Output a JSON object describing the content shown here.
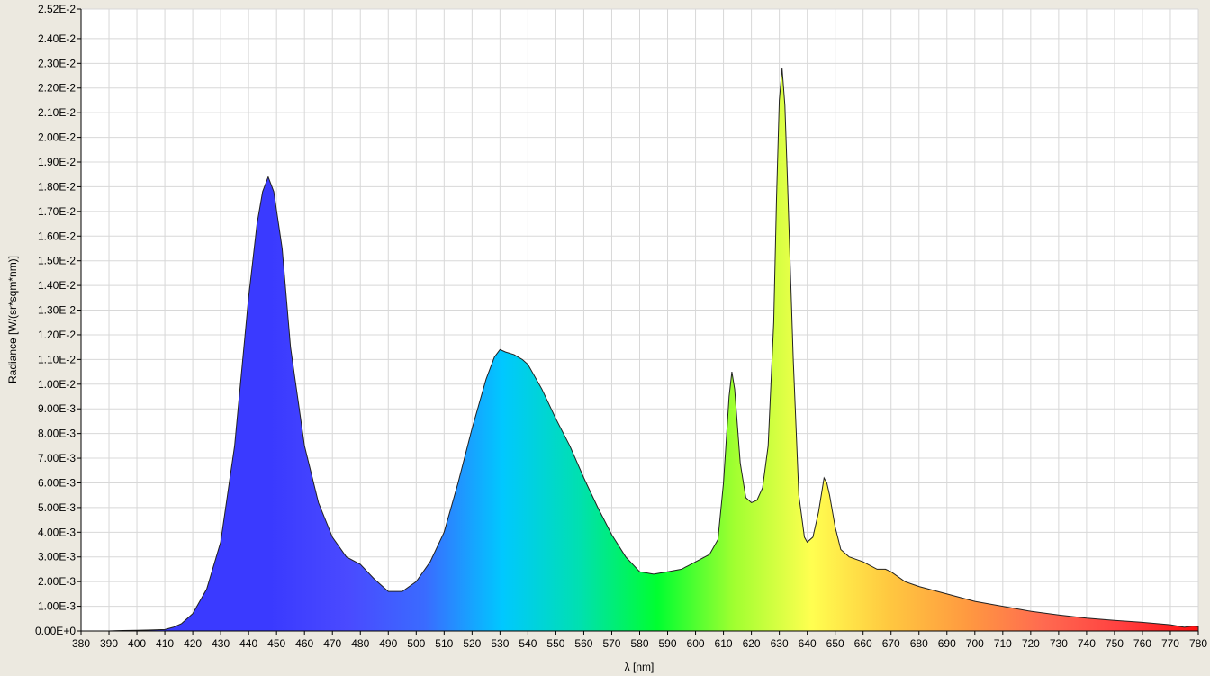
{
  "chart_data": {
    "type": "area",
    "xlabel": "λ [nm]",
    "ylabel": "Radiance [W/(sr*sqm*nm)]",
    "xlim": [
      380,
      780
    ],
    "ylim": [
      0,
      0.0252
    ],
    "grid": true,
    "legend": "none",
    "x_ticks": [
      "380",
      "390",
      "400",
      "410",
      "420",
      "430",
      "440",
      "450",
      "460",
      "470",
      "480",
      "490",
      "500",
      "510",
      "520",
      "530",
      "540",
      "550",
      "560",
      "570",
      "580",
      "590",
      "600",
      "610",
      "620",
      "630",
      "640",
      "650",
      "660",
      "670",
      "680",
      "690",
      "700",
      "710",
      "720",
      "730",
      "740",
      "750",
      "760",
      "770",
      "780"
    ],
    "y_ticks": [
      "0.00E+0",
      "1.00E-3",
      "2.00E-3",
      "3.00E-3",
      "4.00E-3",
      "5.00E-3",
      "6.00E-3",
      "7.00E-3",
      "8.00E-3",
      "9.00E-3",
      "1.00E-2",
      "1.10E-2",
      "1.20E-2",
      "1.30E-2",
      "1.40E-2",
      "1.50E-2",
      "1.60E-2",
      "1.70E-2",
      "1.80E-2",
      "1.90E-2",
      "2.00E-2",
      "2.10E-2",
      "2.20E-2",
      "2.30E-2",
      "2.40E-2",
      "2.52E-2"
    ],
    "fill_colors": [
      "#3a3aff",
      "#3a3aff",
      "#4a4aff",
      "#3a6bff",
      "#00c8ff",
      "#00e0b0",
      "#00ff30",
      "#a0ff30",
      "#ffff50",
      "#ffc840",
      "#ff9a40",
      "#ff6a50",
      "#ff4040",
      "#ff1010"
    ],
    "series": [
      {
        "x": [
          380,
          390,
          395,
          400,
          405,
          410,
          413,
          416,
          420,
          425,
          430,
          435,
          440,
          443,
          445,
          447,
          449,
          452,
          455,
          460,
          465,
          470,
          475,
          480,
          485,
          490,
          495,
          500,
          505,
          510,
          515,
          520,
          525,
          528,
          530,
          532,
          535,
          538,
          540,
          545,
          550,
          555,
          560,
          565,
          570,
          575,
          580,
          585,
          590,
          595,
          600,
          605,
          608,
          610,
          612,
          613,
          614,
          616,
          618,
          620,
          622,
          624,
          626,
          628,
          629,
          630,
          631,
          632,
          633,
          635,
          637,
          639,
          640,
          642,
          644,
          646,
          647,
          648,
          650,
          652,
          655,
          660,
          665,
          668,
          670,
          675,
          680,
          690,
          700,
          710,
          720,
          730,
          740,
          750,
          760,
          770,
          775,
          778,
          780
        ],
        "y": [
          0,
          0,
          2e-05,
          3e-05,
          4e-05,
          6e-05,
          0.00015,
          0.0003,
          0.0007,
          0.0017,
          0.0036,
          0.0075,
          0.0135,
          0.0165,
          0.0178,
          0.0184,
          0.0178,
          0.0155,
          0.0115,
          0.0075,
          0.0052,
          0.0038,
          0.003,
          0.0027,
          0.0021,
          0.0016,
          0.0016,
          0.002,
          0.0028,
          0.004,
          0.006,
          0.0082,
          0.0102,
          0.0111,
          0.0114,
          0.0113,
          0.0112,
          0.011,
          0.0108,
          0.0098,
          0.0086,
          0.0075,
          0.0062,
          0.005,
          0.0039,
          0.003,
          0.0024,
          0.0023,
          0.0024,
          0.0025,
          0.0028,
          0.0031,
          0.0037,
          0.006,
          0.0095,
          0.0105,
          0.0098,
          0.0068,
          0.0054,
          0.0052,
          0.0053,
          0.0058,
          0.0075,
          0.0125,
          0.0175,
          0.0215,
          0.0228,
          0.0213,
          0.018,
          0.011,
          0.0055,
          0.0038,
          0.0036,
          0.0038,
          0.0048,
          0.0062,
          0.006,
          0.0055,
          0.0042,
          0.0033,
          0.003,
          0.0028,
          0.0025,
          0.0025,
          0.0024,
          0.002,
          0.0018,
          0.0015,
          0.0012,
          0.001,
          0.0008,
          0.00065,
          0.00052,
          0.00043,
          0.00035,
          0.00025,
          0.00015,
          0.0002,
          0.00018
        ]
      }
    ]
  }
}
